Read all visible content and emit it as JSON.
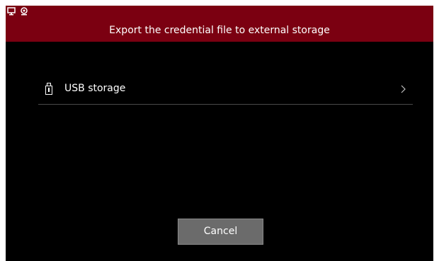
{
  "status_bar": {
    "icons": [
      "monitor-icon",
      "webcam-icon"
    ]
  },
  "header": {
    "title": "Export the credential file to external storage",
    "color": "#7b0011"
  },
  "storage_list": {
    "items": [
      {
        "label": "USB storage",
        "icon": "usb-drive-icon",
        "trailing_icon": "chevron-right-icon"
      }
    ]
  },
  "footer": {
    "cancel_label": "Cancel"
  },
  "colors": {
    "background": "#000000",
    "accent": "#7b0011",
    "button": "#6b6b6b"
  }
}
